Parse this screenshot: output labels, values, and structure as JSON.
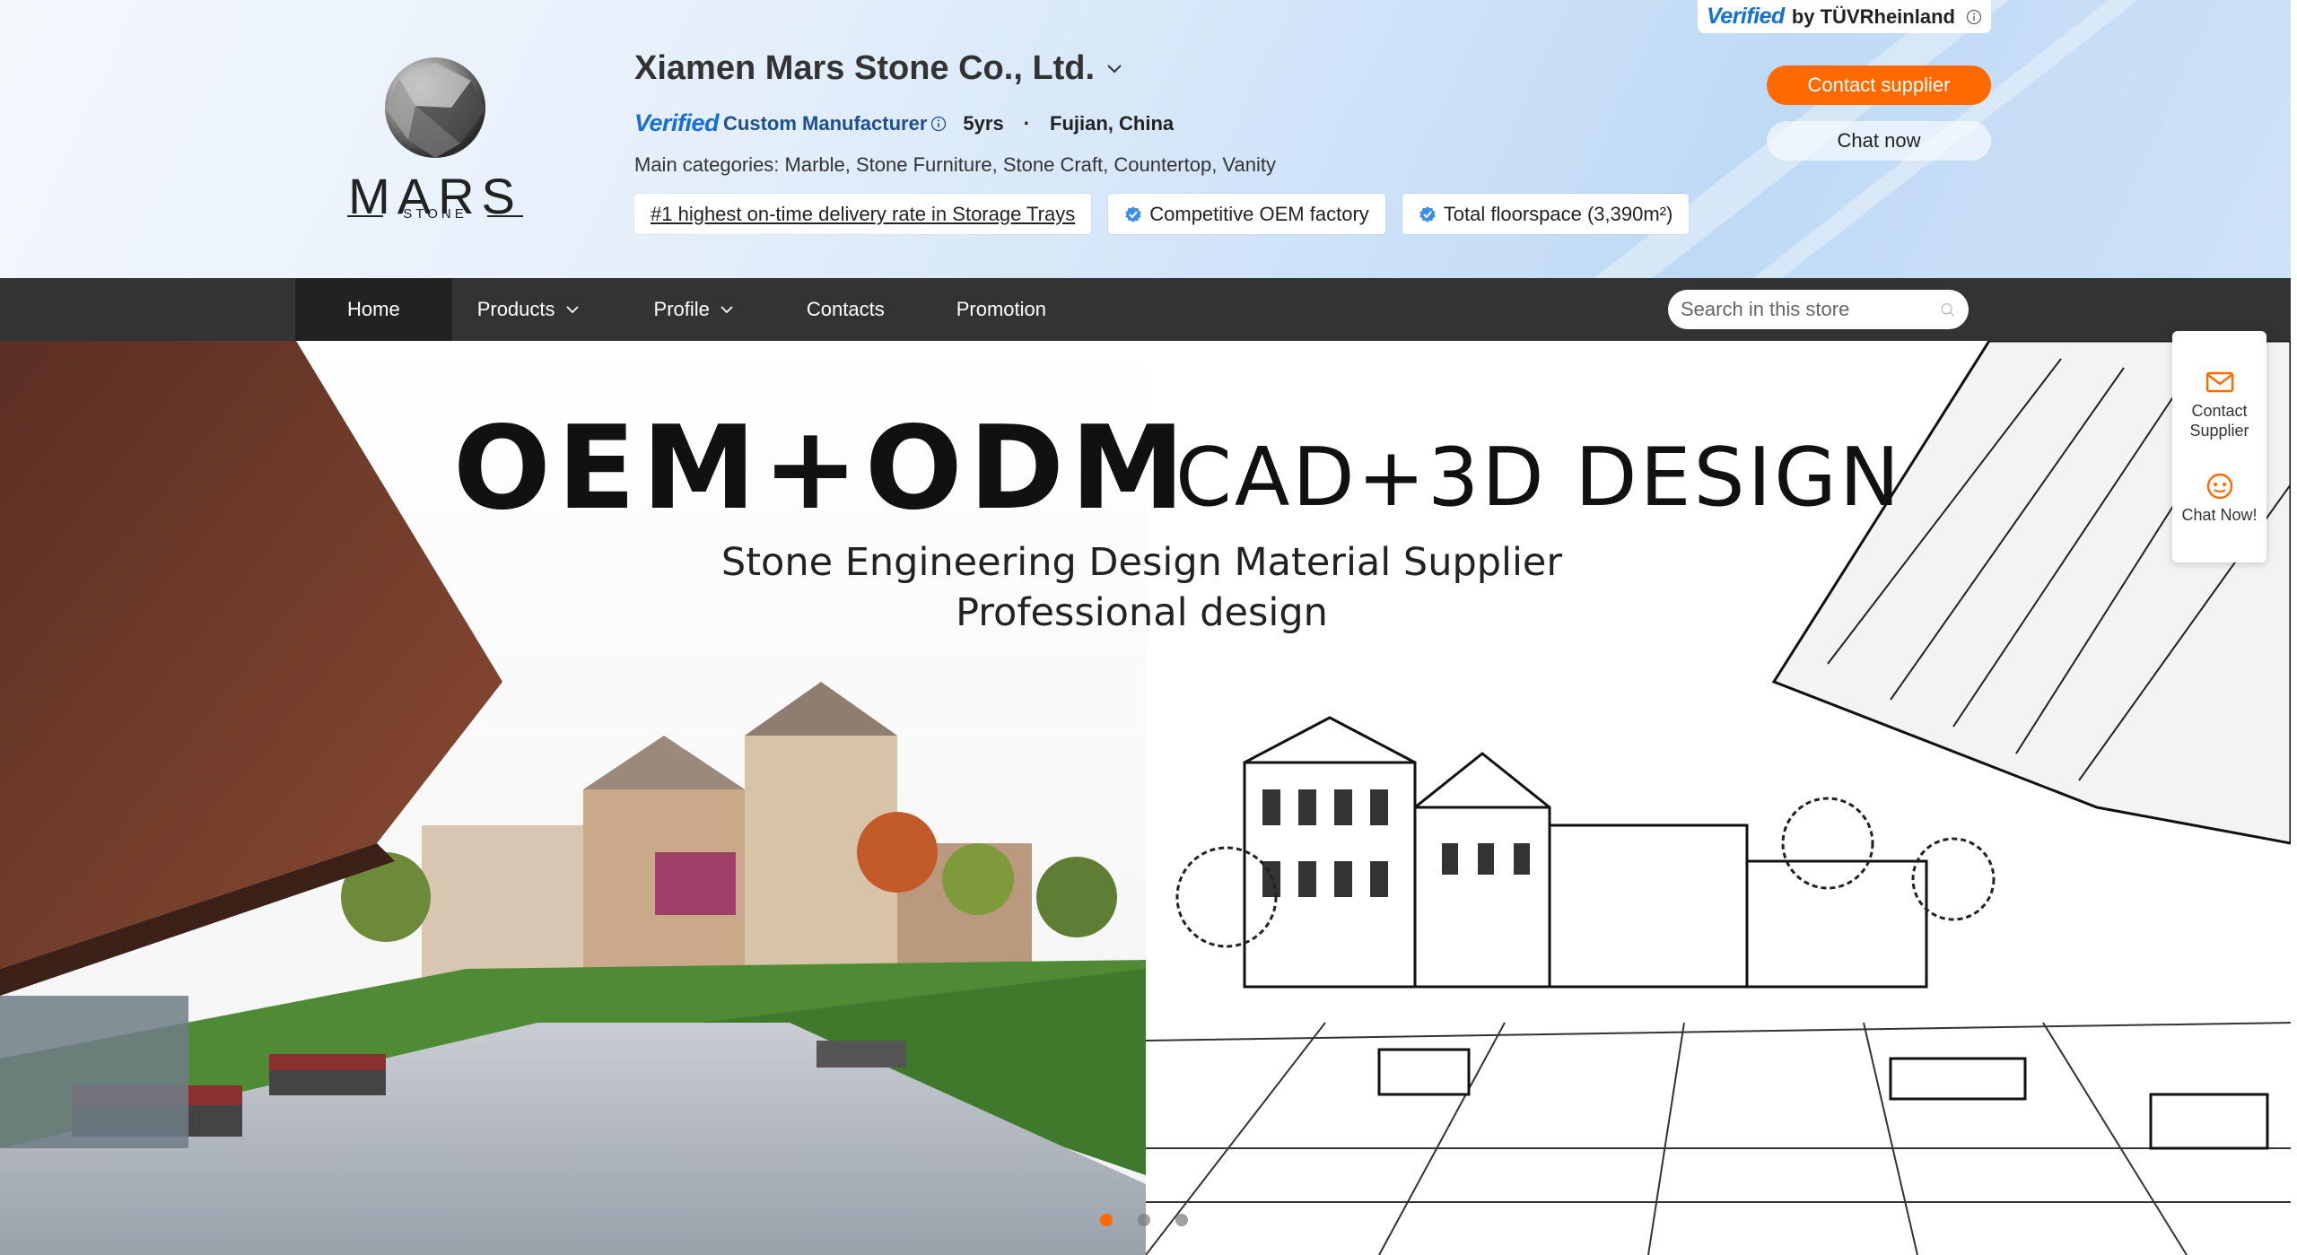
{
  "tuv_badge": {
    "verified": "Verified",
    "by": "by TÜVRheinland"
  },
  "company": {
    "logo_wordmark": "MARS",
    "logo_sub": "STONE",
    "name": "Xiamen Mars Stone Co., Ltd.",
    "verified": "Verified",
    "type": "Custom Manufacturer",
    "years": "5yrs",
    "separator": "·",
    "location": "Fujian, China",
    "categories": "Main categories: Marble, Stone Furniture, Stone Craft, Countertop, Vanity"
  },
  "chips": [
    {
      "label": "#1 highest on-time delivery rate in Storage Trays"
    },
    {
      "label": "Competitive OEM factory"
    },
    {
      "label": "Total floorspace (3,390m²)"
    }
  ],
  "actions": {
    "contact_supplier": "Contact supplier",
    "chat_now": "Chat now"
  },
  "nav": {
    "items": [
      {
        "label": "Home"
      },
      {
        "label": "Products"
      },
      {
        "label": "Profile"
      },
      {
        "label": "Contacts"
      },
      {
        "label": "Promotion"
      }
    ],
    "search_placeholder": "Search in this store"
  },
  "banner": {
    "headline": "OEM+ODM",
    "headline2": "CAD+3D DESIGN",
    "sub1": "Stone Engineering Design Material Supplier",
    "sub2": "Professional design",
    "active_slide": 1,
    "slide_count": 3
  },
  "side_panel": {
    "contact": "Contact Supplier",
    "chat": "Chat Now!"
  },
  "colors": {
    "accent": "#ff6a00",
    "nav_bg": "#333333",
    "verified_blue": "#1d4f91"
  },
  "icons": [
    "chevron-down-icon",
    "info-icon",
    "verified-badge-icon",
    "search-icon",
    "mail-icon",
    "chat-icon"
  ]
}
